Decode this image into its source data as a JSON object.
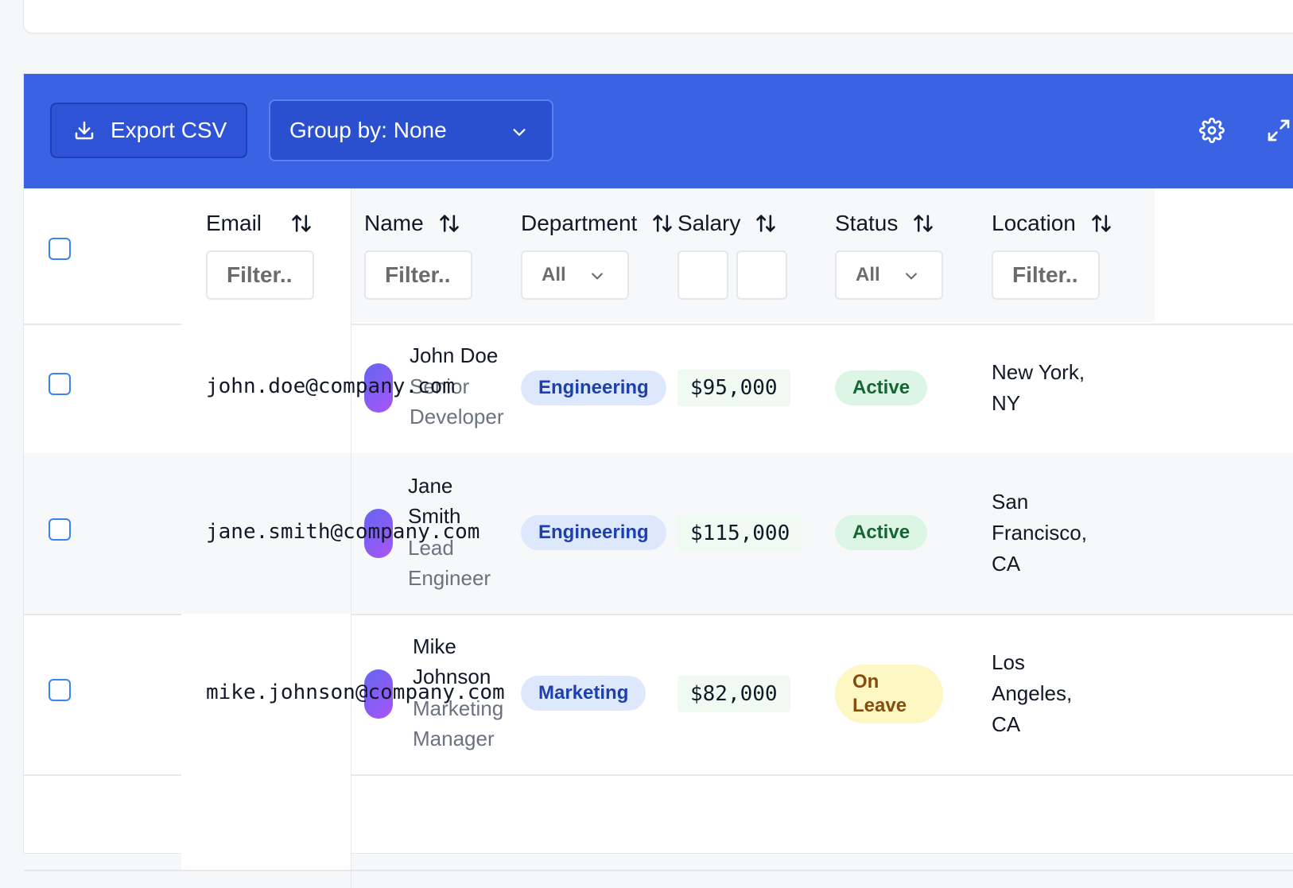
{
  "toolbar": {
    "export_label": "Export CSV",
    "group_by_label": "Group by: None",
    "accent": "#3a63e3"
  },
  "columns": {
    "email": "Email",
    "name": "Name",
    "department": "Department",
    "salary": "Salary",
    "status": "Status",
    "location": "Location"
  },
  "filters": {
    "email_placeholder": "Filter..",
    "name_placeholder": "Filter..",
    "department_selected": "All",
    "status_selected": "All",
    "location_placeholder": "Filter.."
  },
  "rows": [
    {
      "email": "john.doe@company.com",
      "name": "John Doe",
      "role": "Senior Developer",
      "department": "Engineering",
      "salary": "$95,000",
      "status": "Active",
      "location": "New York, NY"
    },
    {
      "email": "jane.smith@company.com",
      "name": "Jane Smith",
      "role": "Lead Engineer",
      "department": "Engineering",
      "salary": "$115,000",
      "status": "Active",
      "location": "San Francisco, CA"
    },
    {
      "email": "mike.johnson@company.com",
      "name": "Mike Johnson",
      "role": "Marketing Manager",
      "department": "Marketing",
      "salary": "$82,000",
      "status": "On Leave",
      "location": "Los Angeles, CA"
    }
  ]
}
